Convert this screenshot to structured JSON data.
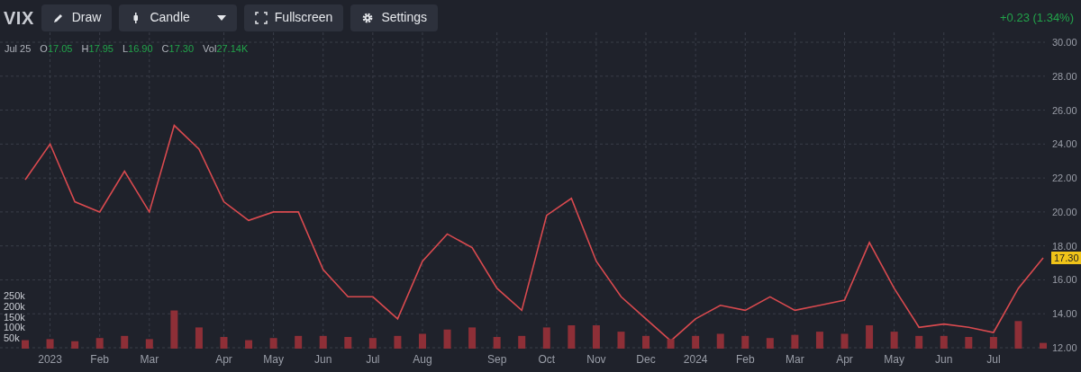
{
  "toolbar": [
    {
      "label": "Draw",
      "dropdown": false
    },
    {
      "label": "Candle",
      "dropdown": true
    },
    {
      "label": "Fullscreen",
      "dropdown": false
    },
    {
      "label": "Settings",
      "dropdown": false
    }
  ],
  "change": "+0.23 (1.34%)",
  "legend": {
    "date": "Jul 25",
    "fields": [
      {
        "key": "O",
        "value": "17.05"
      },
      {
        "key": "H",
        "value": "17.95"
      },
      {
        "key": "L",
        "value": "16.90"
      },
      {
        "key": "C",
        "value": "17.30"
      },
      {
        "key": "Vol",
        "value": "27.14K"
      }
    ]
  },
  "last_price": "17.30",
  "price_chart": {
    "chart_data": {
      "type": "line",
      "categories": [
        null,
        "2023",
        null,
        "Feb",
        null,
        "Mar",
        null,
        null,
        "Apr",
        null,
        "May",
        null,
        "Jun",
        null,
        "Jul",
        null,
        "Aug",
        null,
        null,
        "Sep",
        null,
        "Oct",
        null,
        "Nov",
        null,
        "Dec",
        null,
        "2024",
        null,
        "Feb",
        null,
        "Mar",
        null,
        "Apr",
        null,
        "May",
        null,
        "Jun",
        null,
        "Jul",
        null,
        null
      ],
      "series": [
        {
          "name": "VIX",
          "color": "#d94a4f",
          "values": [
            21.9,
            24.0,
            20.6,
            20.0,
            22.4,
            20.0,
            25.1,
            23.7,
            20.6,
            19.5,
            20.0,
            20.0,
            16.6,
            15.0,
            15.0,
            13.7,
            17.1,
            18.7,
            17.9,
            15.5,
            14.2,
            19.8,
            20.8,
            17.1,
            15.0,
            13.7,
            12.4,
            13.7,
            14.5,
            14.2,
            15.0,
            14.2,
            14.5,
            14.8,
            18.2,
            15.5,
            13.2,
            13.4,
            13.2,
            12.9,
            15.5,
            17.3
          ]
        }
      ],
      "ylim": [
        12,
        30
      ],
      "grid": true,
      "yticks": [
        {
          "value": 12,
          "label": "12.00"
        },
        {
          "value": 14,
          "label": "14.00"
        },
        {
          "value": 16,
          "label": "16.00"
        },
        {
          "value": 18,
          "label": "18.00"
        },
        {
          "value": 20,
          "label": "20.00"
        },
        {
          "value": 22,
          "label": "22.00"
        },
        {
          "value": 24,
          "label": "24.00"
        },
        {
          "value": 26,
          "label": "26.00"
        },
        {
          "value": 28,
          "label": "28.00"
        },
        {
          "value": 30,
          "label": "30.00"
        }
      ]
    }
  },
  "volume_chart": {
    "chart_data": {
      "type": "bar",
      "categories": [
        null,
        null,
        null,
        null,
        null,
        null,
        null,
        null,
        null,
        null,
        null,
        null,
        null,
        null,
        null,
        null,
        null,
        null,
        null,
        null,
        null,
        null,
        null,
        null,
        null,
        null,
        null,
        null,
        null,
        null,
        null,
        null,
        null,
        null,
        null,
        null,
        null,
        null,
        null,
        null,
        null,
        null
      ],
      "series": [
        {
          "color": "#8e2f37",
          "values": [
            40000,
            45000,
            35000,
            50000,
            60000,
            45000,
            180000,
            100000,
            55000,
            40000,
            50000,
            60000,
            60000,
            55000,
            50000,
            60000,
            70000,
            90000,
            100000,
            55000,
            60000,
            100000,
            110000,
            110000,
            80000,
            60000,
            45000,
            60000,
            70000,
            60000,
            50000,
            65000,
            80000,
            70000,
            110000,
            80000,
            60000,
            60000,
            55000,
            55000,
            130000,
            27000
          ]
        }
      ],
      "ylim": [
        0,
        250000
      ],
      "yticks": [
        {
          "value": 50000,
          "label": "50k"
        },
        {
          "value": 100000,
          "label": "100k"
        },
        {
          "value": 150000,
          "label": "150k"
        },
        {
          "value": 200000,
          "label": "200k"
        },
        {
          "value": 250000,
          "label": "250k"
        }
      ]
    }
  }
}
